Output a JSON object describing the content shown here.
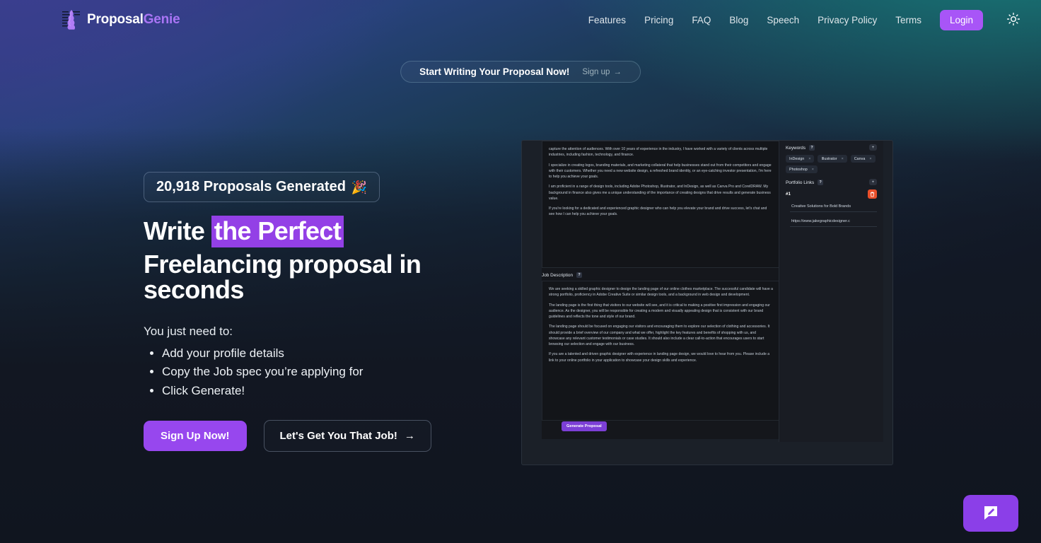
{
  "header": {
    "brand": {
      "name_primary": "Proposal",
      "name_secondary": "Genie",
      "icon": "genie-lamp-icon"
    },
    "nav": [
      {
        "label": "Features"
      },
      {
        "label": "Pricing"
      },
      {
        "label": "FAQ"
      },
      {
        "label": "Blog"
      },
      {
        "label": "Speech"
      },
      {
        "label": "Privacy Policy"
      },
      {
        "label": "Terms"
      }
    ],
    "login_label": "Login",
    "theme_toggle_icon": "sun-icon"
  },
  "announce": {
    "text": "Start Writing Your Proposal Now!",
    "link_label": "Sign up",
    "link_arrow": "→"
  },
  "hero": {
    "counter_text": "20,918 Proposals Generated",
    "counter_emoji": "🎉",
    "headline_line1_pre": "Write ",
    "headline_line1_highlight": "the Perfect",
    "headline_line2": "Freelancing proposal in seconds",
    "need_title": "You just need to:",
    "need_items": [
      "Add your profile details",
      "Copy the Job spec you’re applying for",
      "Click Generate!"
    ],
    "cta_primary": "Sign Up Now!",
    "cta_secondary": "Let's Get You That Job!",
    "cta_secondary_arrow": "→"
  },
  "app_shot": {
    "bio_paragraphs": [
      "capture the attention of audiences. With over 10 years of experience in the industry, I have worked with a variety of clients across multiple industries, including fashion, technology, and finance.",
      "I specialize in creating logos, branding materials, and marketing collateral that help businesses stand out from their competitors and engage with their customers. Whether you need a new website design, a refreshed brand identity, or an eye-catching investor presentation, I'm here to help you achieve your goals.",
      "I am proficient in a range of design tools, including Adobe Photoshop, Illustrator, and InDesign, as well as Canva Pro and CorelDRAW. My background in finance also gives me a unique understanding of the importance of creating designs that drive results and generate business value.",
      "If you're looking for a dedicated and experienced graphic designer who can help you elevate your brand and drive success, let's chat and see how I can help you achieve your goals."
    ],
    "job_description_label": "Job Description",
    "help_badge": "?",
    "job_description_paragraphs": [
      "We are seeking a skilled graphic designer to design the landing page of our online clothes marketplace. The successful candidate will have a strong portfolio, proficiency in Adobe Creative Suite or similar design tools, and a background in web design and development.",
      "The landing page is the first thing that visitors to our website will see, and it is critical to making a positive first impression and engaging our audience. As the designer, you will be responsible for creating a modern and visually appealing design that is consistent with our brand guidelines and reflects the tone and style of our brand.",
      "The landing page should be focused on engaging our visitors and encouraging them to explore our selection of clothing and accessories. It should provide a brief overview of our company and what we offer, highlight the key features and benefits of shopping with us, and showcase any relevant customer testimonials or case studies. It should also include a clear call-to-action that encourages users to start browsing our selection and engage with our business.",
      "If you are a talented and driven graphic designer with experience in landing page design, we would love to hear from you. Please include a link to your online portfolio in your application to showcase your design skills and experience."
    ],
    "generate_button": "Generate Proposal",
    "keywords_label": "Keywords",
    "keywords_add": "+",
    "keywords": [
      "InDesign",
      "Illustrator",
      "Canva",
      "Photoshop"
    ],
    "tag_remove": "×",
    "portfolio_label": "Portfolio Links",
    "portfolio_add": "+",
    "portfolio_entry_number": "#1",
    "portfolio_delete_icon": "trash-icon",
    "portfolio_title": "Creative Solutions for Bold Brands",
    "portfolio_url": "https://www.jakegraphicdesigner.c"
  },
  "feedback": {
    "icon": "feedback-chat-pen-icon"
  },
  "colors": {
    "accent_purple": "#a855f7",
    "highlight_purple": "#9340e6",
    "danger_orange": "#ea4f2a",
    "bg_indigo": "#343a80",
    "bg_teal": "#17807c"
  }
}
